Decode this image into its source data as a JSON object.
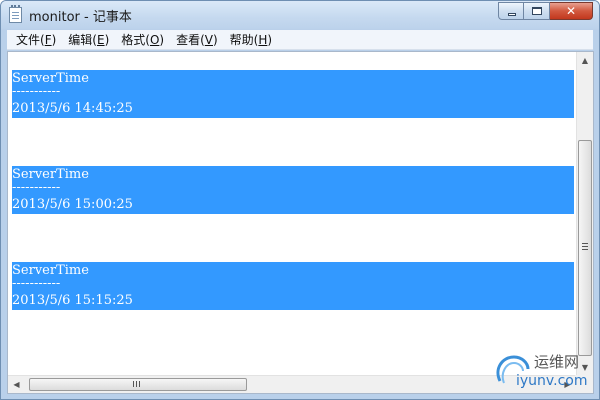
{
  "window": {
    "title": "monitor - 记事本",
    "icon": "notepad-icon",
    "buttons": {
      "minimize": "minimize-icon",
      "maximize": "maximize-icon",
      "close": "close-icon"
    }
  },
  "menu": [
    {
      "text": "文件(",
      "key": "F",
      "end": ")"
    },
    {
      "text": "编辑(",
      "key": "E",
      "end": ")"
    },
    {
      "text": "格式(",
      "key": "O",
      "end": ")"
    },
    {
      "text": "查看(",
      "key": "V",
      "end": ")"
    },
    {
      "text": "帮助(",
      "key": "H",
      "end": ")"
    }
  ],
  "document": {
    "selection_color": "#3399ff",
    "blocks": [
      {
        "label": "ServerTime",
        "separator": "-----------",
        "timestamp": "2013/5/6 14:45:25"
      },
      {
        "label": "ServerTime",
        "separator": "-----------",
        "timestamp": "2013/5/6 15:00:25"
      },
      {
        "label": "ServerTime",
        "separator": "-----------",
        "timestamp": "2013/5/6 15:15:25"
      }
    ]
  },
  "watermark": {
    "top": "运维网",
    "bottom": "iyunv.com"
  }
}
